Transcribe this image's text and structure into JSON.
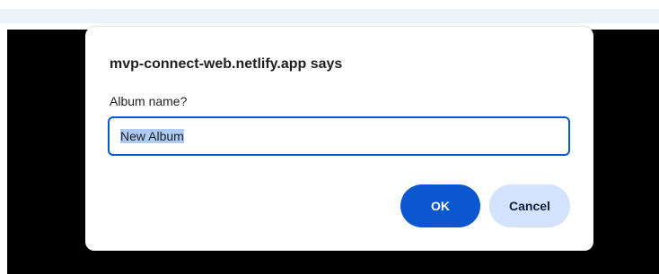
{
  "dialog": {
    "title": "mvp-connect-web.netlify.app says",
    "message": "Album name?",
    "input_value": "New Album",
    "ok_label": "OK",
    "cancel_label": "Cancel"
  },
  "colors": {
    "accent": "#0b57d0",
    "cancel_bg": "#d3e3fd",
    "backdrop": "#000000",
    "top_strip": "#eef2f9"
  }
}
